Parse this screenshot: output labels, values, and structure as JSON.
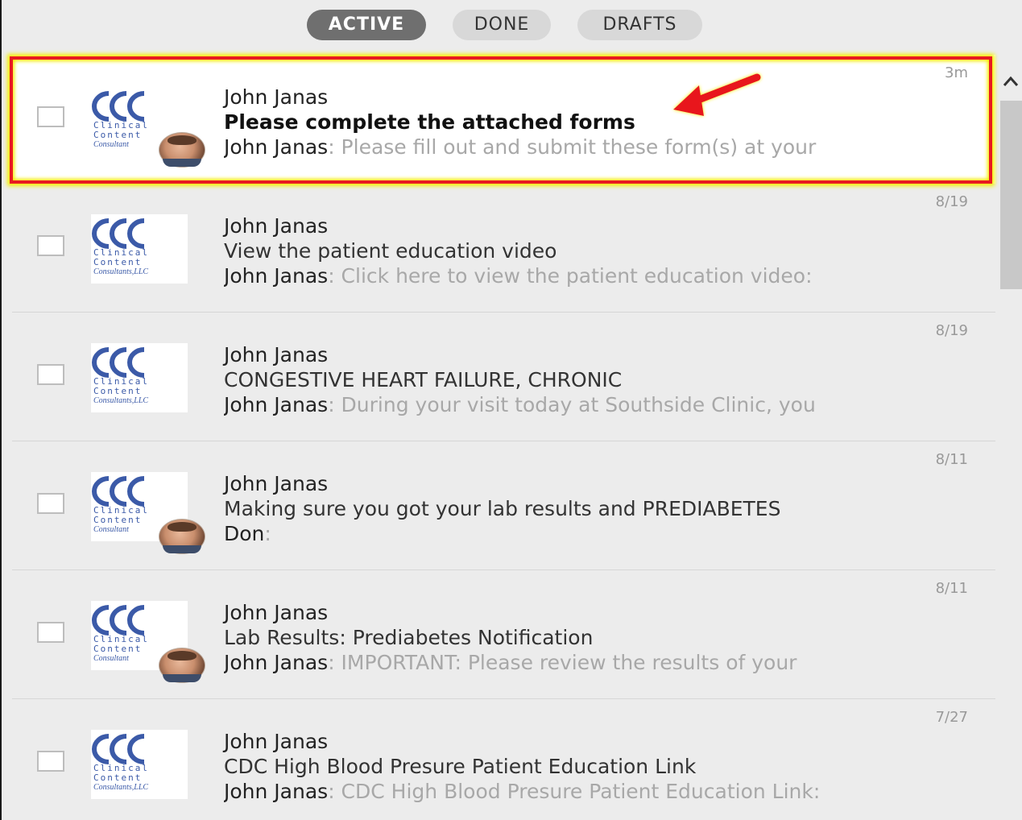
{
  "tabs": [
    {
      "label": "ACTIVE",
      "active": true
    },
    {
      "label": "DONE",
      "active": false
    },
    {
      "label": "DRAFTS",
      "active": false
    }
  ],
  "logo": {
    "line1": "Clinical",
    "line2": "Content",
    "line3": "Consultants,LLC",
    "line3_short": "Consultant"
  },
  "messages": [
    {
      "sender": "John Janas",
      "subject": "Please complete the attached forms",
      "preview_from": "John Janas",
      "preview_text": ": Please fill out and submit these form(s) at your",
      "time": "3m",
      "has_avatar": true,
      "unread": true
    },
    {
      "sender": "John Janas",
      "subject": "View the patient education video",
      "preview_from": "John Janas",
      "preview_text": ": Click here to view the patient education video:",
      "time": "8/19",
      "has_avatar": false,
      "unread": false
    },
    {
      "sender": "John Janas",
      "subject": "CONGESTIVE HEART FAILURE, CHRONIC",
      "preview_from": "John Janas",
      "preview_text": ": During your visit today at Southside Clinic, you",
      "time": "8/19",
      "has_avatar": false,
      "unread": false
    },
    {
      "sender": "John Janas",
      "subject": "Making sure you got your lab results and PREDIABETES",
      "preview_from": "Don",
      "preview_text": ":",
      "time": "8/11",
      "has_avatar": true,
      "unread": false
    },
    {
      "sender": "John Janas",
      "subject": "Lab Results: Prediabetes Notification",
      "preview_from": "John Janas",
      "preview_text": ": IMPORTANT: Please review the results of your",
      "time": "8/11",
      "has_avatar": true,
      "unread": false
    },
    {
      "sender": "John Janas",
      "subject": "CDC High Blood Presure Patient Education Link",
      "preview_from": "John Janas",
      "preview_text": ": CDC High Blood Presure Patient Education Link:",
      "time": "7/27",
      "has_avatar": false,
      "unread": false
    }
  ],
  "colors": {
    "highlight_border": "#e8191f",
    "highlight_glow": "#f5f000",
    "arrow": "#e8191f",
    "tab_active": "#6f6f6f"
  },
  "icons": {
    "scroll_up": "chevron-up-icon",
    "annotation": "red-arrow-icon"
  }
}
